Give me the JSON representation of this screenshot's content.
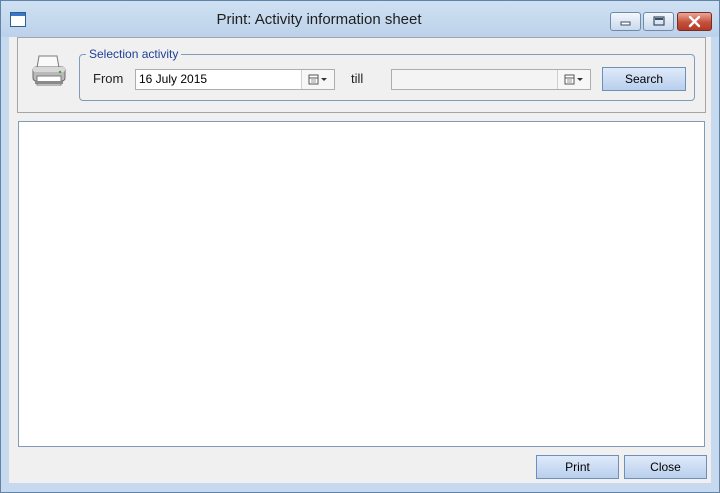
{
  "window": {
    "title": "Print: Activity information sheet",
    "controls": [
      "minimize-icon",
      "maximize-icon",
      "close-icon"
    ]
  },
  "selection": {
    "group_label": "Selection activity",
    "from_label": "From",
    "from_value": "16 July 2015",
    "till_label": "till",
    "till_value": "",
    "search_label": "Search"
  },
  "footer": {
    "print_label": "Print",
    "close_label": "Close"
  },
  "colors": {
    "titlebar": "#c6d9ee",
    "button": "#c9dbf1",
    "group_text": "#1f3f99",
    "close_red": "#c5503a"
  }
}
